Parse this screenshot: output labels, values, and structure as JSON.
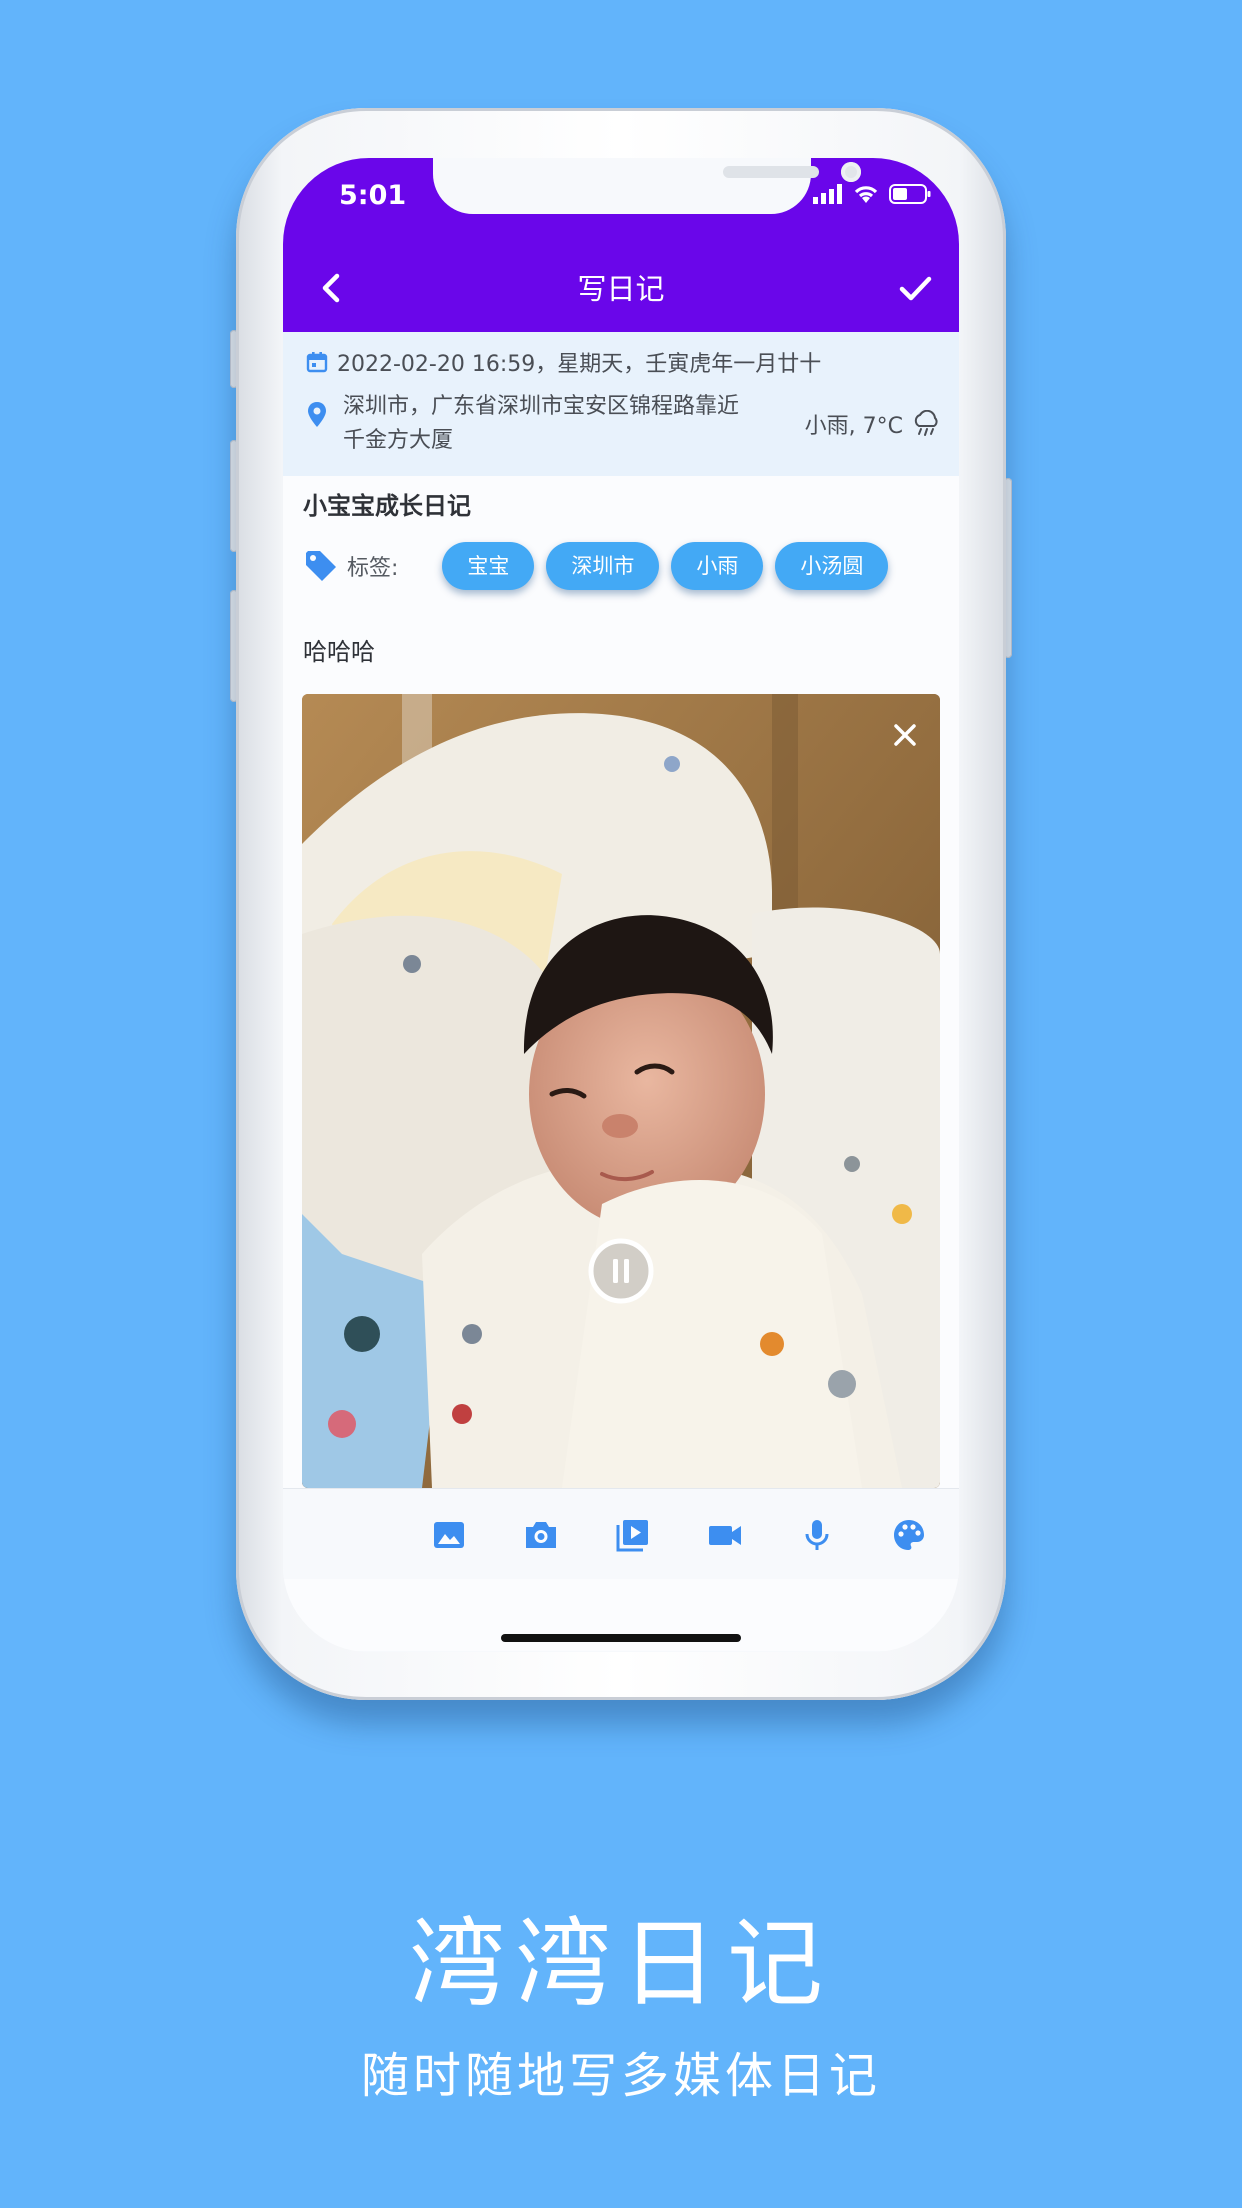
{
  "status_bar": {
    "time": "5:01"
  },
  "app_bar": {
    "title": "写日记"
  },
  "entry": {
    "datetime": "2022-02-20 16:59，星期天，壬寅虎年一月廿十",
    "location": "深圳市，广东省深圳市宝安区锦程路靠近千金方大厦",
    "weather": "小雨, 7°C",
    "title": "小宝宝成长日记",
    "tags_label": "标签:",
    "tags": [
      "宝宝",
      "深圳市",
      "小雨",
      "小汤圆"
    ],
    "body": "哈哈哈"
  },
  "toolbar": {
    "icons": [
      "image-icon",
      "camera-icon",
      "video-library-icon",
      "videocam-icon",
      "mic-icon",
      "palette-icon"
    ]
  },
  "colors": {
    "app_bar": "#6a06ea",
    "accent": "#3d8ef0",
    "chip": "#43a9f5",
    "background": "#62b4fb"
  },
  "caption": {
    "app_name": "湾湾日记",
    "tagline": "随时随地写多媒体日记"
  }
}
